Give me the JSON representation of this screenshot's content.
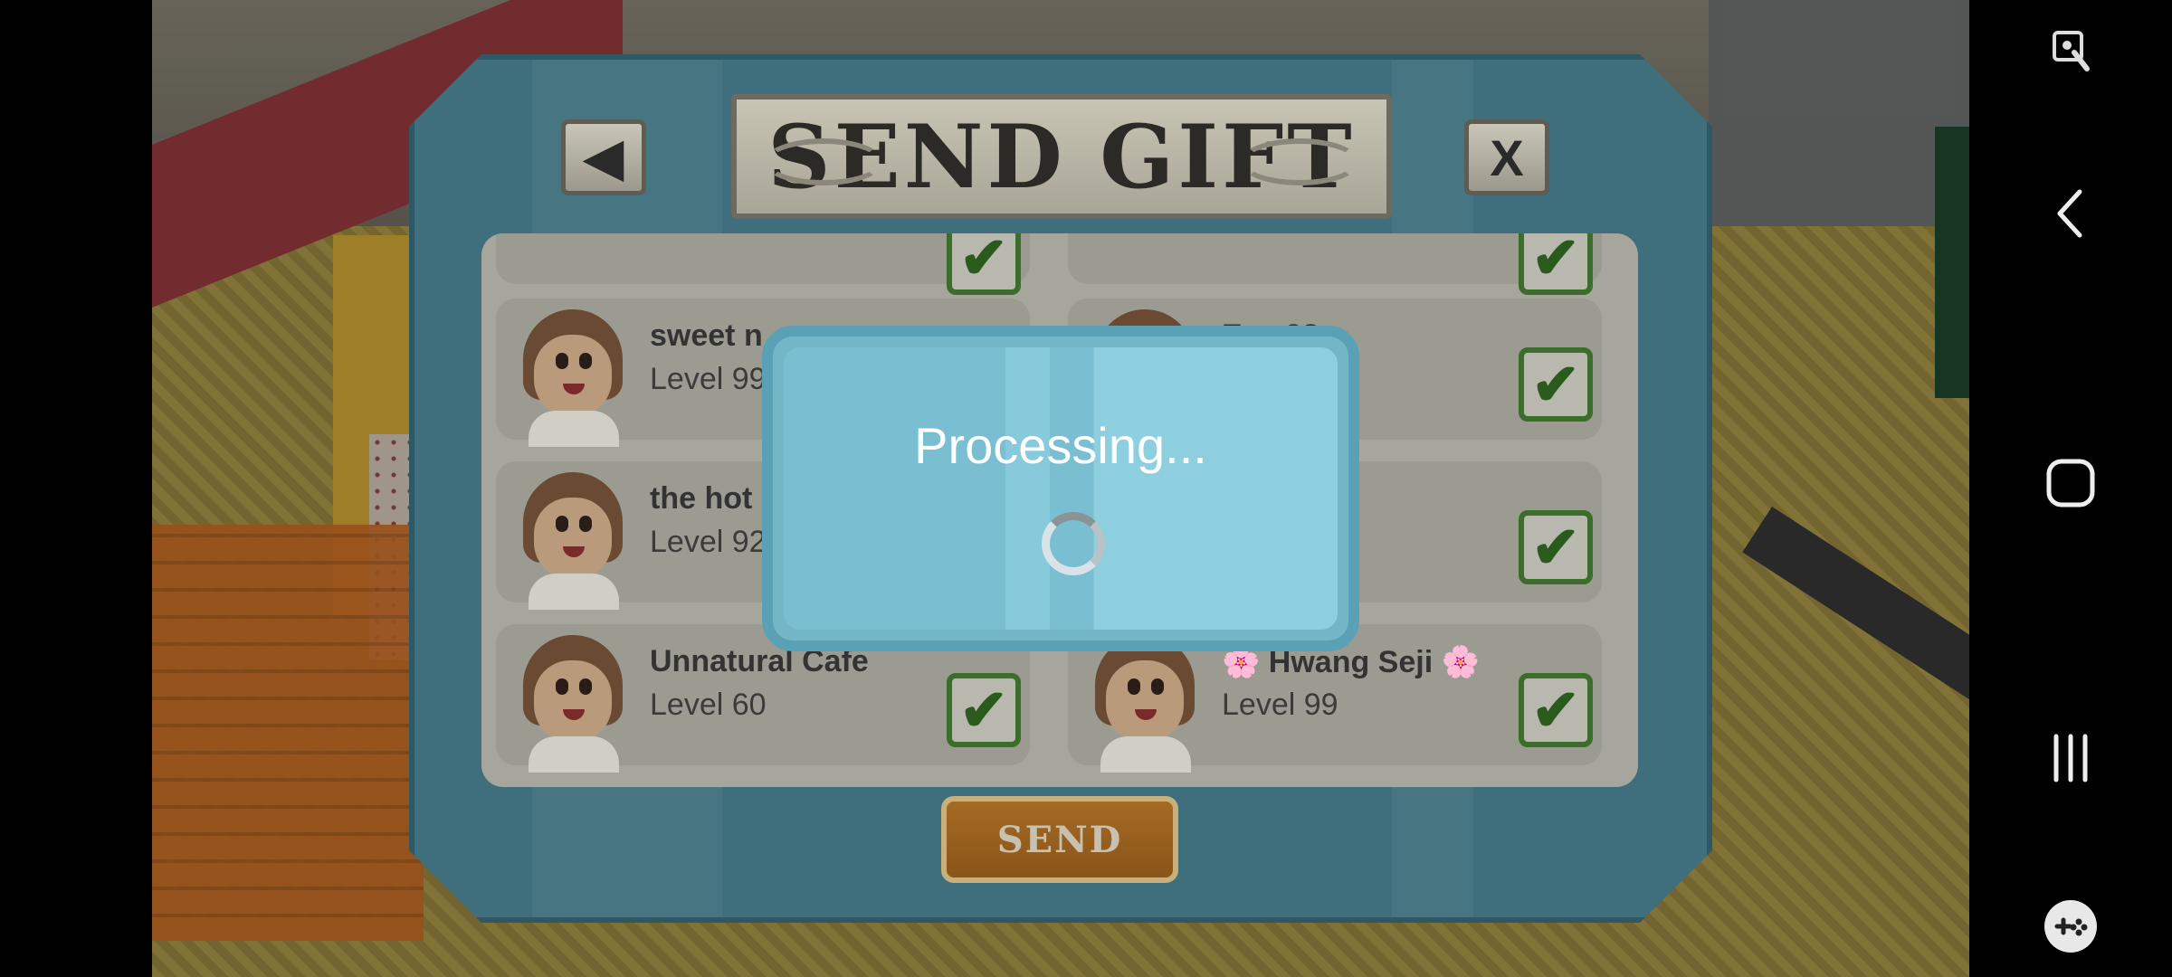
{
  "dialog": {
    "title": "SEND GIFT",
    "back_symbol": "◀",
    "close_symbol": "X",
    "send_label": "SEND"
  },
  "processing": {
    "text": "Processing..."
  },
  "friends": [
    {
      "name": "sweet n",
      "level": "Level 99",
      "checked": true
    },
    {
      "name": "Evy 98",
      "level": "",
      "checked": true
    },
    {
      "name": "the hot",
      "level": "Level 92",
      "checked": true
    },
    {
      "name": "",
      "level": "",
      "checked": true
    },
    {
      "name": "Unnatural Cafe",
      "level": "Level 60",
      "checked": true
    },
    {
      "name": "🌸 Hwang Seji 🌸",
      "level": "Level 99",
      "checked": true
    }
  ],
  "checkmark": "✔",
  "navbar": {
    "icons": [
      "screenshot-icon",
      "back-icon",
      "home-icon",
      "recents-icon",
      "game-tools-icon"
    ]
  },
  "colors": {
    "panel": "#3f6e7c",
    "dialog": "#72b6c8",
    "check_green": "#3b6e2a",
    "send_button": "#a56a24"
  }
}
